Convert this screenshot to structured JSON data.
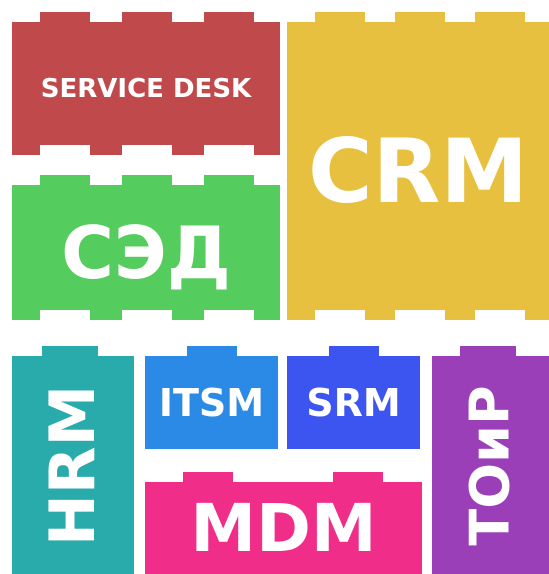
{
  "tiles": {
    "service_desk": {
      "label": "SERVICE DESK",
      "color": "#c04a4b"
    },
    "crm": {
      "label": "CRM",
      "color": "#e8c040"
    },
    "sed": {
      "label": "СЭД",
      "color": "#55cc5e"
    },
    "hrm": {
      "label": "HRM",
      "color": "#2aabab"
    },
    "itsm": {
      "label": "ITSM",
      "color": "#2a8ae6"
    },
    "srm": {
      "label": "SRM",
      "color": "#3d55f0"
    },
    "toir": {
      "label": "ТОиР",
      "color": "#9a3fb8"
    },
    "mdm": {
      "label": "MDM",
      "color": "#f02e8a"
    }
  }
}
